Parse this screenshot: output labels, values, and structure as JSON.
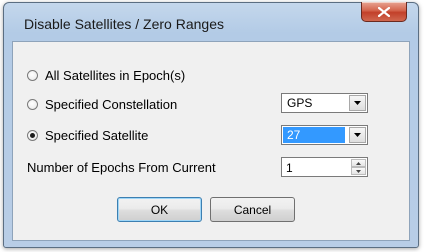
{
  "window": {
    "title": "Disable Satellites / Zero Ranges"
  },
  "options": [
    {
      "label": "All Satellites in Epoch(s)",
      "checked": false
    },
    {
      "label": "Specified Constellation",
      "checked": false
    },
    {
      "label": "Specified Satellite",
      "checked": true
    }
  ],
  "constellation_combo": {
    "value": "GPS"
  },
  "satellite_combo": {
    "value": "27",
    "selected": true
  },
  "epochs": {
    "label": "Number of Epochs From Current",
    "value": "1"
  },
  "buttons": {
    "ok": "OK",
    "cancel": "Cancel"
  },
  "icons": {
    "close": "close-icon",
    "dropdown": "chevron-down-icon",
    "spin_up": "spin-up-icon",
    "spin_down": "spin-down-icon"
  },
  "colors": {
    "selection": "#3399ff",
    "close_button": "#c2402a",
    "window_frame": "#b3cbe6"
  }
}
